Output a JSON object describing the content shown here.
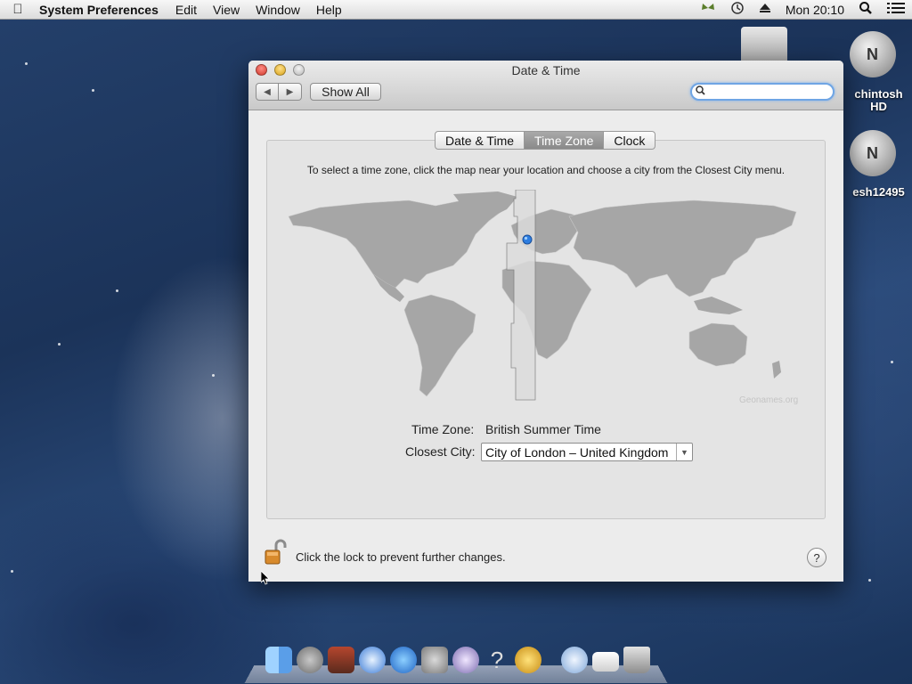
{
  "menubar": {
    "apple": "",
    "app_name": "System Preferences",
    "items": [
      "Edit",
      "View",
      "Window",
      "Help"
    ],
    "clock": "Mon 20:10"
  },
  "desktop": {
    "icons": [
      {
        "label": "chintosh\nHD"
      },
      {
        "label": "esh12495"
      }
    ]
  },
  "window": {
    "title": "Date & Time",
    "toolbar": {
      "back": "◀",
      "forward": "▶",
      "show_all": "Show All",
      "search_placeholder": ""
    },
    "tabs": [
      {
        "label": "Date & Time",
        "active": false
      },
      {
        "label": "Time Zone",
        "active": true
      },
      {
        "label": "Clock",
        "active": false
      }
    ],
    "instructions": "To select a time zone, click the map near your location and choose a city from the Closest City menu.",
    "map_credit": "Geonames.org",
    "time_zone_label": "Time Zone:",
    "time_zone_value": "British Summer Time",
    "closest_city_label": "Closest City:",
    "closest_city_value": "City of London – United Kingdom",
    "lock_text": "Click the lock to prevent further changes.",
    "help": "?"
  },
  "dock": {
    "items": [
      "finder-icon",
      "launchpad-icon",
      "photo-booth-icon",
      "safari-icon",
      "app-store-icon",
      "system-preferences-icon",
      "wizard-icon",
      "help-icon",
      "bee-icon",
      "prohibited-app-icon",
      "screen-icon",
      "trash-icon"
    ]
  },
  "colors": {
    "accent_blue": "#6fa5e4",
    "active_tab": "#8a8a8a"
  }
}
